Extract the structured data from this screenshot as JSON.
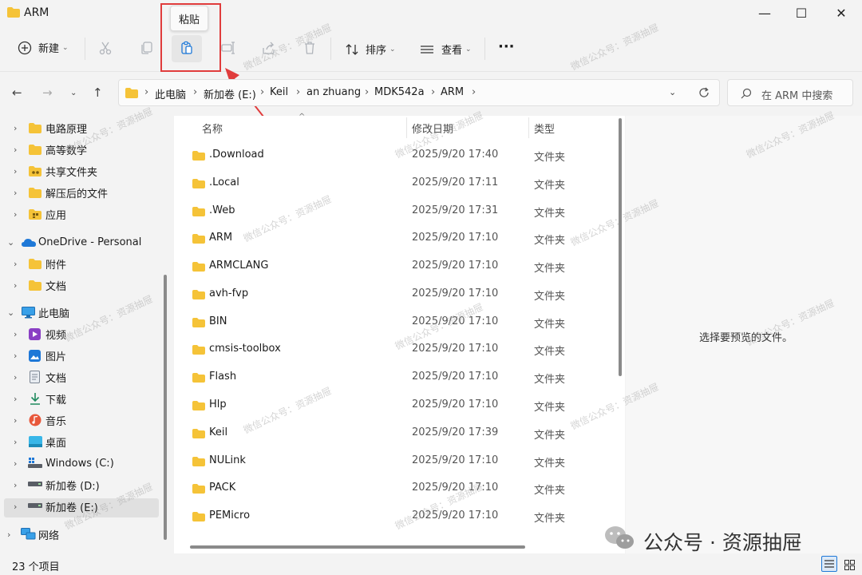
{
  "window": {
    "title": "ARM",
    "minimize": "—",
    "maximize": "☐",
    "close": "✕"
  },
  "tooltip": {
    "text": "粘贴"
  },
  "toolbar": {
    "new_label": "新建",
    "sort_label": "排序",
    "view_label": "查看",
    "more_label": "···"
  },
  "address": {
    "crumbs": [
      "此电脑",
      "新加卷 (E:)",
      "Keil",
      "an zhuang",
      "MDK542a",
      "ARM"
    ]
  },
  "search": {
    "placeholder": "在 ARM 中搜索"
  },
  "nav": {
    "items": [
      {
        "label": "电路原理"
      },
      {
        "label": "高等数学"
      },
      {
        "label": "共享文件夹"
      },
      {
        "label": "解压后的文件"
      },
      {
        "label": "应用"
      },
      {
        "label": "OneDrive - Personal"
      },
      {
        "label": "附件"
      },
      {
        "label": "文档"
      },
      {
        "label": "此电脑"
      },
      {
        "label": "视频"
      },
      {
        "label": "图片"
      },
      {
        "label": "文档"
      },
      {
        "label": "下载"
      },
      {
        "label": "音乐"
      },
      {
        "label": "桌面"
      },
      {
        "label": "Windows (C:)"
      },
      {
        "label": "新加卷 (D:)"
      },
      {
        "label": "新加卷 (E:)"
      },
      {
        "label": "网络"
      }
    ]
  },
  "columns": {
    "name": "名称",
    "date": "修改日期",
    "type": "类型"
  },
  "files": [
    {
      "name": ".Download",
      "date": "2025/9/20 17:40",
      "type": "文件夹"
    },
    {
      "name": ".Local",
      "date": "2025/9/20 17:11",
      "type": "文件夹"
    },
    {
      "name": ".Web",
      "date": "2025/9/20 17:31",
      "type": "文件夹"
    },
    {
      "name": "ARM",
      "date": "2025/9/20 17:10",
      "type": "文件夹"
    },
    {
      "name": "ARMCLANG",
      "date": "2025/9/20 17:10",
      "type": "文件夹"
    },
    {
      "name": "avh-fvp",
      "date": "2025/9/20 17:10",
      "type": "文件夹"
    },
    {
      "name": "BIN",
      "date": "2025/9/20 17:10",
      "type": "文件夹"
    },
    {
      "name": "cmsis-toolbox",
      "date": "2025/9/20 17:10",
      "type": "文件夹"
    },
    {
      "name": "Flash",
      "date": "2025/9/20 17:10",
      "type": "文件夹"
    },
    {
      "name": "Hlp",
      "date": "2025/9/20 17:10",
      "type": "文件夹"
    },
    {
      "name": "Keil",
      "date": "2025/9/20 17:39",
      "type": "文件夹"
    },
    {
      "name": "NULink",
      "date": "2025/9/20 17:10",
      "type": "文件夹"
    },
    {
      "name": "PACK",
      "date": "2025/9/20 17:10",
      "type": "文件夹"
    },
    {
      "name": "PEMicro",
      "date": "2025/9/20 17:10",
      "type": "文件夹"
    }
  ],
  "preview": {
    "text": "选择要预览的文件。"
  },
  "status": {
    "count": "23 个项目"
  },
  "watermark": {
    "text": "微信公众号：资源抽屉",
    "logo": "公众号 · 资源抽屉"
  },
  "colors": {
    "accent": "#e03c3c",
    "folder": "#f5c338",
    "onedrive": "#1e78d7"
  }
}
